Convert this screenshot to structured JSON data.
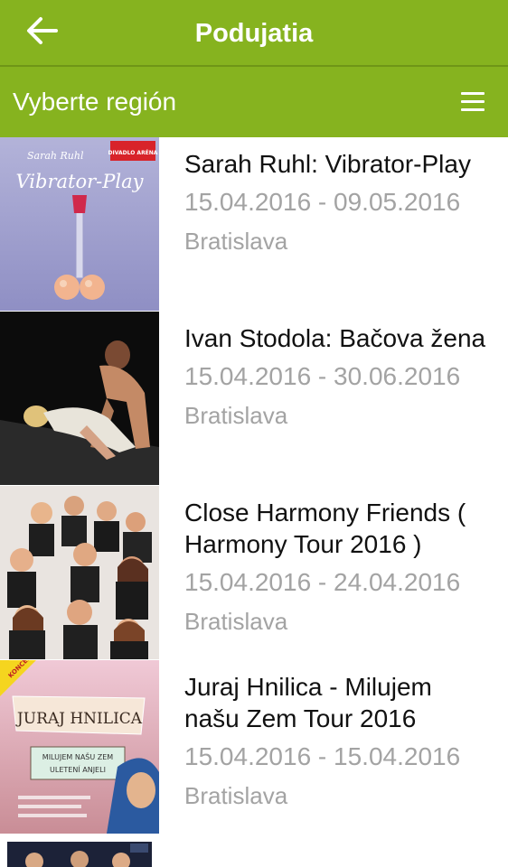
{
  "header": {
    "title": "Podujatia",
    "back_icon": "back-arrow-icon"
  },
  "region": {
    "label": "Vyberte región",
    "menu_icon": "hamburger-menu-icon"
  },
  "colors": {
    "brand_green": "#86b31f",
    "title_text": "#111111",
    "secondary_text": "#a3a3a3"
  },
  "events": [
    {
      "title": "Sarah Ruhl: Vibrator-Play",
      "dates": "15.04.2016 - 09.05.2016",
      "city": "Bratislava",
      "poster": {
        "author": "Sarah Ruhl",
        "title": "Vibrator-Play",
        "badge": "DIVADLO ARÉNA"
      }
    },
    {
      "title": "Ivan Stodola: Bačova žena",
      "dates": "15.04.2016 - 30.06.2016",
      "city": "Bratislava"
    },
    {
      "title": "Close Harmony Friends ( Harmony Tour 2016 )",
      "dates": "15.04.2016 - 24.04.2016",
      "city": "Bratislava"
    },
    {
      "title": "Juraj Hnilica - Milujem našu Zem Tour 2016",
      "dates": "15.04.2016 - 15.04.2016",
      "city": "Bratislava",
      "poster": {
        "badge": "KONCERT",
        "name": "JURAJ HNILICA",
        "line1": "MILUJEM NAŠU ZEM",
        "line2": "ULETENÍ ANJELI"
      }
    }
  ]
}
